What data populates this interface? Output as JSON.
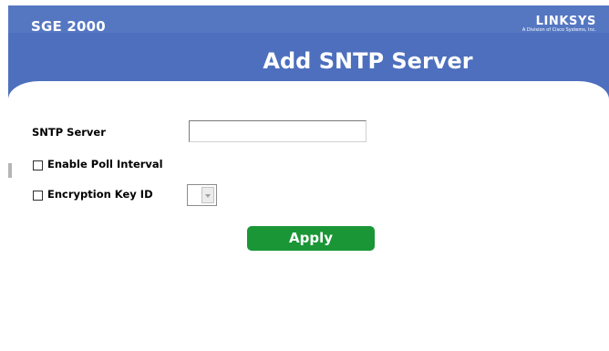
{
  "header": {
    "product": "SGE 2000",
    "brand_name": "LINKSYS",
    "brand_tagline": "A Division of Cisco Systems, Inc.",
    "title": "Add SNTP Server"
  },
  "form": {
    "sntp_server_label": "SNTP Server",
    "sntp_server_value": "",
    "enable_poll_label": "Enable Poll Interval",
    "enable_poll_checked": false,
    "encryption_key_label": "Encryption Key ID",
    "encryption_key_checked": false,
    "encryption_key_selected": ""
  },
  "actions": {
    "apply_label": "Apply"
  },
  "colors": {
    "header": "#4d6fbd",
    "apply": "#1a9636"
  }
}
